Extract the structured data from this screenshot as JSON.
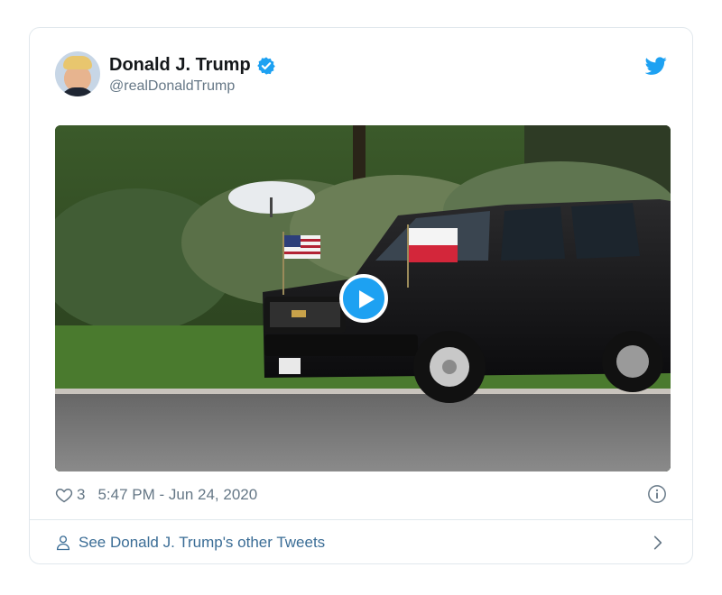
{
  "tweet": {
    "author": {
      "display_name": "Donald J. Trump",
      "handle": "@realDonaldTrump",
      "verified": true
    },
    "media": {
      "type": "video",
      "description_icons": [
        "play-icon"
      ]
    },
    "likes": "3",
    "timestamp": "5:47 PM - Jun 24, 2020",
    "footer_link": "See Donald J. Trump's other Tweets"
  },
  "colors": {
    "accent": "#1da1f2",
    "link": "#3b6d96",
    "muted": "#657786",
    "border": "#e1e8ed"
  }
}
